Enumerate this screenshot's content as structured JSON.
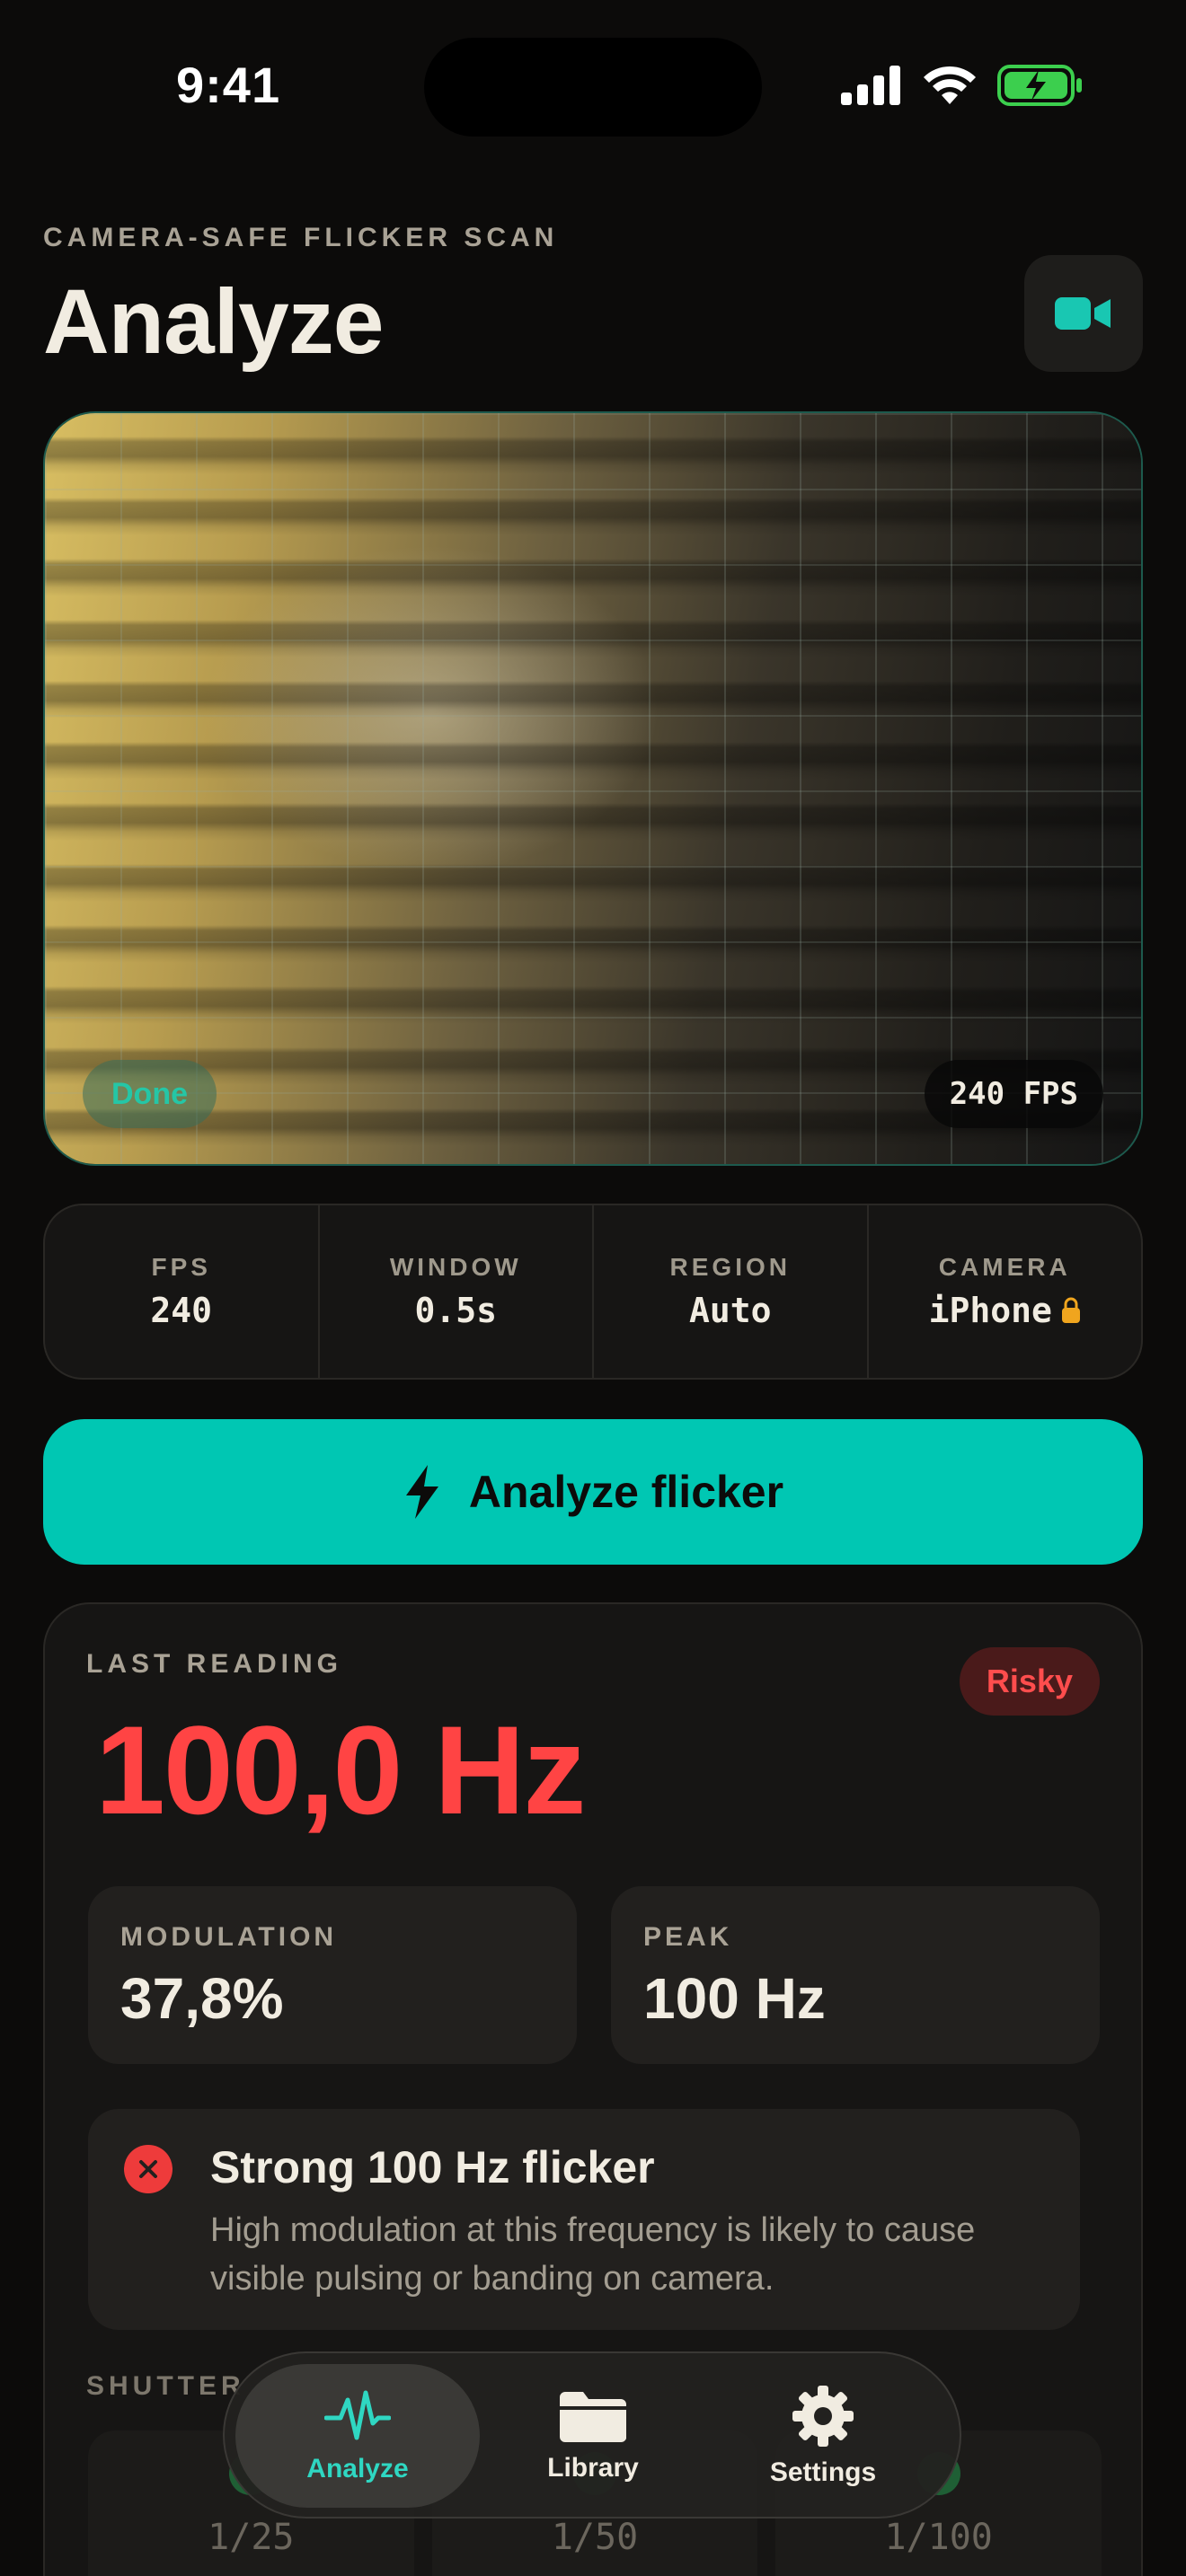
{
  "status_bar": {
    "time": "9:41"
  },
  "header": {
    "overline": "CAMERA-SAFE FLICKER SCAN",
    "title": "Analyze"
  },
  "preview": {
    "status": "Done",
    "fps_badge": "240 FPS"
  },
  "stats": [
    {
      "label": "FPS",
      "value": "240"
    },
    {
      "label": "WINDOW",
      "value": "0.5s"
    },
    {
      "label": "REGION",
      "value": "Auto"
    },
    {
      "label": "CAMERA",
      "value": "iPhone"
    }
  ],
  "cta": {
    "label": "Analyze flicker"
  },
  "reading": {
    "label": "LAST READING",
    "badge": "Risky",
    "frequency": "100,0 Hz",
    "modulation_label": "MODULATION",
    "modulation_value": "37,8%",
    "peak_label": "PEAK",
    "peak_value": "100 Hz",
    "warning_title": "Strong 100 Hz flicker",
    "warning_text": "High modulation at this frequency is likely to cause visible pulsing or banding on camera.",
    "shutter_label": "SHUTTER",
    "shutter_values": [
      "1/25",
      "1/50",
      "1/100"
    ]
  },
  "tabs": [
    {
      "label": "Analyze",
      "icon": "waveform-icon",
      "active": true
    },
    {
      "label": "Library",
      "icon": "folder-icon",
      "active": false
    },
    {
      "label": "Settings",
      "icon": "gear-icon",
      "active": false
    }
  ],
  "colors": {
    "accent": "#00c7b3",
    "danger": "#ff4444",
    "background": "#0c0b0a",
    "card": "#161514"
  }
}
